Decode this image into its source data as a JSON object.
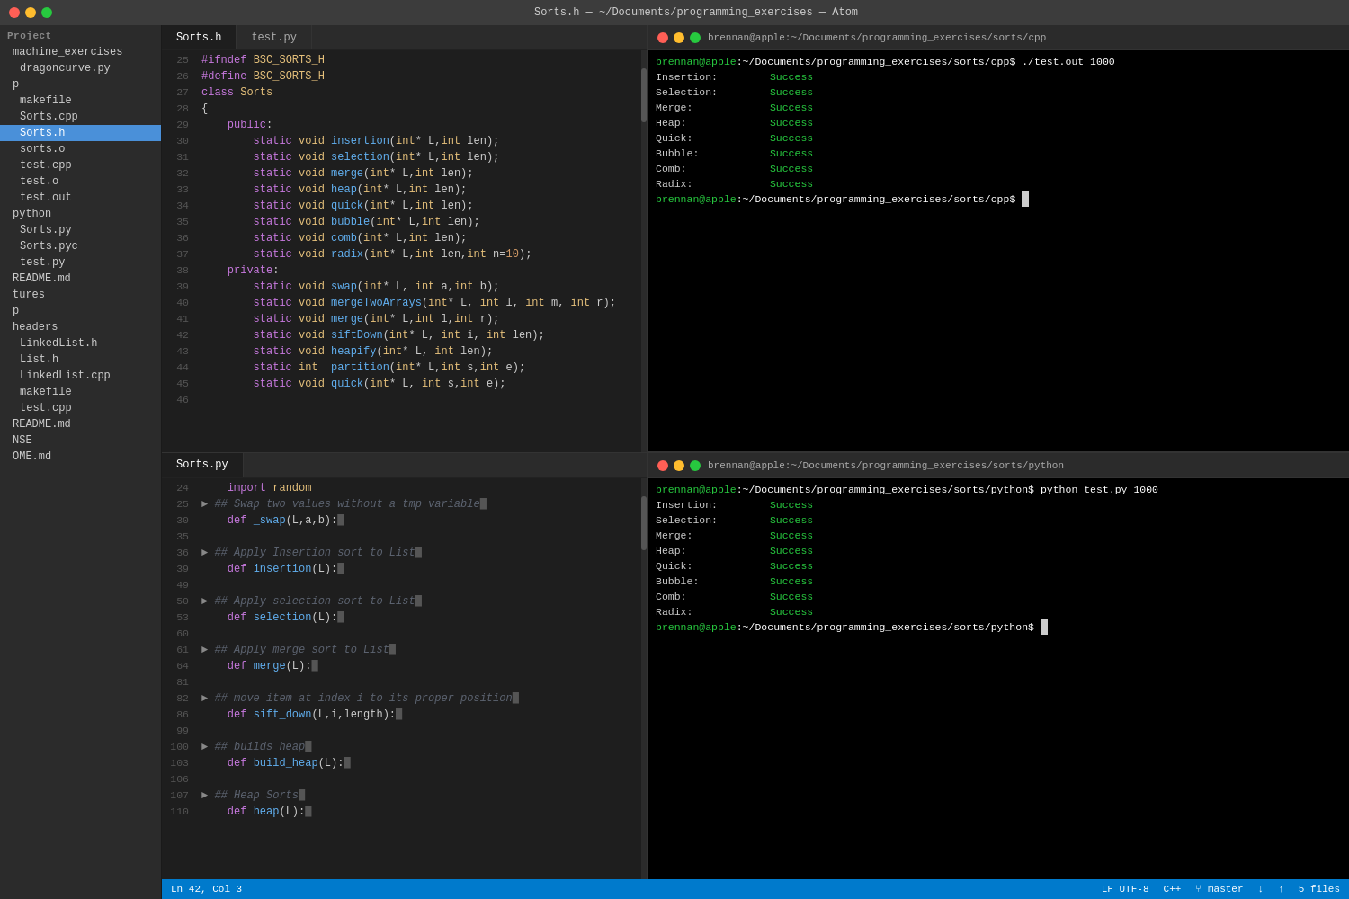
{
  "topbar": {
    "title": "Sorts.h — ~/Documents/programming_exercises — Atom",
    "traffic_lights": [
      "red",
      "yellow",
      "green"
    ]
  },
  "sidebar": {
    "project_label": "Project",
    "items": [
      {
        "label": "machine_exercises",
        "type": "folder",
        "indent": 0
      },
      {
        "label": "dragoncurve.py",
        "type": "file",
        "indent": 1
      },
      {
        "label": "p",
        "type": "folder",
        "indent": 0
      },
      {
        "label": "makefile",
        "type": "file",
        "indent": 1
      },
      {
        "label": "Sorts.cpp",
        "type": "file",
        "indent": 1
      },
      {
        "label": "Sorts.h",
        "type": "file",
        "indent": 1,
        "active": true
      },
      {
        "label": "sorts.o",
        "type": "file",
        "indent": 1
      },
      {
        "label": "test.cpp",
        "type": "file",
        "indent": 1
      },
      {
        "label": "test.o",
        "type": "file",
        "indent": 1
      },
      {
        "label": "test.out",
        "type": "file",
        "indent": 1
      },
      {
        "label": "python",
        "type": "folder",
        "indent": 0
      },
      {
        "label": "Sorts.py",
        "type": "file",
        "indent": 1
      },
      {
        "label": "Sorts.pyc",
        "type": "file",
        "indent": 1
      },
      {
        "label": "test.py",
        "type": "file",
        "indent": 1
      },
      {
        "label": "README.md",
        "type": "file",
        "indent": 0
      },
      {
        "label": "tures",
        "type": "folder",
        "indent": 0
      },
      {
        "label": "p",
        "type": "folder",
        "indent": 0
      },
      {
        "label": "headers",
        "type": "folder",
        "indent": 0
      },
      {
        "label": "LinkedList.h",
        "type": "file",
        "indent": 1
      },
      {
        "label": "List.h",
        "type": "file",
        "indent": 1
      },
      {
        "label": "LinkedList.cpp",
        "type": "file",
        "indent": 1
      },
      {
        "label": "makefile",
        "type": "file",
        "indent": 1
      },
      {
        "label": "test.cpp",
        "type": "file",
        "indent": 1
      },
      {
        "label": "README.md",
        "type": "file",
        "indent": 0
      },
      {
        "label": "NSE",
        "type": "folder",
        "indent": 0
      },
      {
        "label": "OME.md",
        "type": "file",
        "indent": 0
      }
    ]
  },
  "editor": {
    "tabs": [
      {
        "label": "Sorts.h",
        "active": true
      },
      {
        "label": "test.py",
        "active": false
      }
    ],
    "sorts_h": {
      "lines": [
        {
          "num": 25,
          "content": "#ifndef BSC_SORTS_H"
        },
        {
          "num": 26,
          "content": "#define BSC_SORTS_H"
        },
        {
          "num": 27,
          "content": "class Sorts"
        },
        {
          "num": 28,
          "content": "{"
        },
        {
          "num": 29,
          "content": "    public:"
        },
        {
          "num": 30,
          "content": "        static void insertion(int* L,int len);"
        },
        {
          "num": 31,
          "content": "        static void selection(int* L,int len);"
        },
        {
          "num": 32,
          "content": "        static void merge(int* L,int len);"
        },
        {
          "num": 33,
          "content": "        static void heap(int* L,int len);"
        },
        {
          "num": 34,
          "content": "        static void quick(int* L,int len);"
        },
        {
          "num": 35,
          "content": "        static void bubble(int* L,int len);"
        },
        {
          "num": 36,
          "content": "        static void comb(int* L,int len);"
        },
        {
          "num": 37,
          "content": "        static void radix(int* L,int len,int n=10);"
        },
        {
          "num": 38,
          "content": "    private:"
        },
        {
          "num": 39,
          "content": "        static void swap(int* L, int a,int b);"
        },
        {
          "num": 40,
          "content": "        static void mergeTwoArrays(int* L, int l, int m, int r);"
        },
        {
          "num": 41,
          "content": "        static void merge(int* L,int l,int r);"
        },
        {
          "num": 42,
          "content": "        static void siftDown(int* L, int i, int len);"
        },
        {
          "num": 43,
          "content": "        static void heapify(int* L, int len);"
        },
        {
          "num": 44,
          "content": "        static int  partition(int* L,int s,int e);"
        },
        {
          "num": 45,
          "content": "        static void quick(int* L, int s,int e);"
        },
        {
          "num": 46,
          "content": ""
        }
      ]
    },
    "sorts_py": {
      "tab_label": "Sorts.py",
      "lines": [
        {
          "num": 24,
          "content": "    import random"
        },
        {
          "num": 25,
          "content": "> ## Swap two values without a tmp variable="
        },
        {
          "num": 30,
          "content": "    def _swap(L,a,b):="
        },
        {
          "num": 35,
          "content": ""
        },
        {
          "num": 36,
          "content": "> ## Apply Insertion sort to List="
        },
        {
          "num": 39,
          "content": "    def insertion(L):="
        },
        {
          "num": 49,
          "content": ""
        },
        {
          "num": 50,
          "content": "> ## Apply selection sort to List="
        },
        {
          "num": 53,
          "content": "    def selection(L):="
        },
        {
          "num": 60,
          "content": ""
        },
        {
          "num": 61,
          "content": "> ## Apply merge sort to List="
        },
        {
          "num": 64,
          "content": "    def merge(L):="
        },
        {
          "num": 81,
          "content": ""
        },
        {
          "num": 82,
          "content": "> ## move item at index i to its proper position="
        },
        {
          "num": 86,
          "content": "    def sift_down(L,i,length):="
        },
        {
          "num": 99,
          "content": ""
        },
        {
          "num": 100,
          "content": "> ## builds heap="
        },
        {
          "num": 103,
          "content": "    def build_heap(L):="
        },
        {
          "num": 106,
          "content": ""
        },
        {
          "num": 107,
          "content": "> ## Heap Sorts="
        },
        {
          "num": 110,
          "content": "    def heap(L):="
        }
      ]
    }
  },
  "terminal": {
    "top": {
      "title": "brennan@apple:~/Documents/programming_exercises/sorts/cpp",
      "command": "./test.out 1000",
      "results": [
        {
          "label": "Insertion:",
          "status": "Success"
        },
        {
          "label": "Selection:",
          "status": "Success"
        },
        {
          "label": "Merge:",
          "status": "Success"
        },
        {
          "label": "Heap:",
          "status": "Success"
        },
        {
          "label": "Quick:",
          "status": "Success"
        },
        {
          "label": "Bubble:",
          "status": "Success"
        },
        {
          "label": "Comb:",
          "status": "Success"
        },
        {
          "label": "Radix:",
          "status": "Success"
        }
      ],
      "prompt": "brennan@apple:~/Documents/programming_exercises/sorts/cpp$"
    },
    "bottom": {
      "title": "brennan@apple:~/Documents/programming_exercises/sorts/python",
      "command": "python test.py 1000",
      "results": [
        {
          "label": "Insertion:",
          "status": "Success"
        },
        {
          "label": "Selection:",
          "status": "Success"
        },
        {
          "label": "Merge:",
          "status": "Success"
        },
        {
          "label": "Heap:",
          "status": "Success"
        },
        {
          "label": "Quick:",
          "status": "Success"
        },
        {
          "label": "Bubble:",
          "status": "Success"
        },
        {
          "label": "Comb:",
          "status": "Success"
        },
        {
          "label": "Radix:",
          "status": "Success"
        }
      ],
      "prompt": "brennan@apple:~/Documents/programming_exercises/sorts/python$"
    }
  },
  "statusbar": {
    "position": "Ln 42, Col 3",
    "encoding": "LF  UTF-8",
    "language": "C++",
    "branch": "master",
    "files": "5 files"
  }
}
